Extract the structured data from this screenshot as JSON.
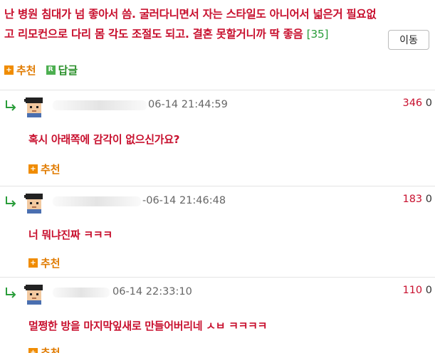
{
  "post": {
    "line1": "난 병원 침대가 넘 좋아서 씀. 굴러다니면서 자는 스타일도 아니어서 넓은거 필요없",
    "line2": "고 리모컨으로 다리 몸 각도 조절도 되고. 결혼 못할거니까 딱 좋음",
    "comment_count": "[35]",
    "move_label": "이동"
  },
  "actions": {
    "recommend_label": "추천",
    "reply_label": "답글",
    "reply_badge": "R",
    "plus_badge": "+"
  },
  "comments": [
    {
      "date": "06-14 21:44:59",
      "num_a": "346",
      "num_b": "0",
      "text": "혹시 아래쪽에 감각이 없으신가요?",
      "recommend_label": "추천"
    },
    {
      "date": "-06-14 21:46:48",
      "num_a": "183",
      "num_b": "0",
      "text": "너 뭐냐진짜 ㅋㅋㅋ",
      "recommend_label": "추천"
    },
    {
      "date": "06-14 22:33:10",
      "num_a": "110",
      "num_b": "0",
      "text": "멀쩡한 방을 마지막잎새로 만들어버리네 ㅅㅂ ㅋㅋㅋㅋ",
      "recommend_label": "추천"
    }
  ],
  "colors": {
    "text_red": "#c8102e",
    "recommend_orange": "#e07b00",
    "reply_green": "#2a8f2a",
    "count_green": "#2a9d3a"
  }
}
